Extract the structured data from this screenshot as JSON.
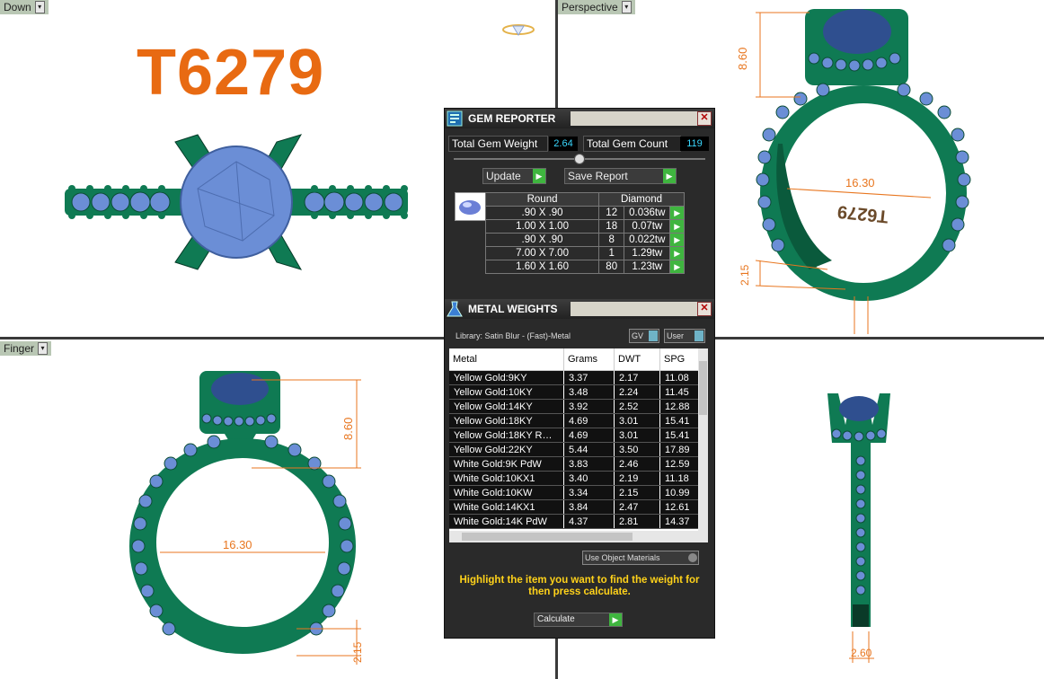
{
  "viewports": {
    "top_left_label": "Down",
    "top_right_label": "Perspective",
    "bottom_left_label": "Finger"
  },
  "logo_text": "T6279",
  "dimensions": {
    "front_height": "8.60",
    "front_inner": "16.30",
    "front_band": "2.15",
    "persp_height": "8.60",
    "persp_inner": "16.30",
    "persp_band": "2.15",
    "side_width": "2.60",
    "engraving": "T6279"
  },
  "gem_reporter": {
    "title": "GEM REPORTER",
    "total_weight_label": "Total Gem Weight",
    "total_weight_value": "2.64",
    "total_count_label": "Total Gem Count",
    "total_count_value": "119",
    "update_label": "Update",
    "save_report_label": "Save Report",
    "col_shape": "Round",
    "col_material": "Diamond",
    "rows": [
      {
        "size": ".90 X .90",
        "count": "12",
        "weight": "0.036tw"
      },
      {
        "size": "1.00 X 1.00",
        "count": "18",
        "weight": "0.07tw"
      },
      {
        "size": ".90 X .90",
        "count": "8",
        "weight": "0.022tw"
      },
      {
        "size": "7.00 X 7.00",
        "count": "1",
        "weight": "1.29tw"
      },
      {
        "size": "1.60 X 1.60",
        "count": "80",
        "weight": "1.23tw"
      }
    ]
  },
  "metal_weights": {
    "title": "METAL WEIGHTS",
    "library": "Library: Satin Blur - (Fast)-Metal",
    "gv_label": "GV",
    "user_label": "User",
    "headers": [
      "Metal",
      "Grams",
      "DWT",
      "SPG"
    ],
    "rows": [
      [
        "Yellow Gold:9KY",
        "3.37",
        "2.17",
        "11.08"
      ],
      [
        "Yellow Gold:10KY",
        "3.48",
        "2.24",
        "11.45"
      ],
      [
        "Yellow Gold:14KY",
        "3.92",
        "2.52",
        "12.88"
      ],
      [
        "Yellow Gold:18KY",
        "4.69",
        "3.01",
        "15.41"
      ],
      [
        "Yellow Gold:18KY R…",
        "4.69",
        "3.01",
        "15.41"
      ],
      [
        "Yellow Gold:22KY",
        "5.44",
        "3.50",
        "17.89"
      ],
      [
        "White Gold:9K PdW",
        "3.83",
        "2.46",
        "12.59"
      ],
      [
        "White Gold:10KX1",
        "3.40",
        "2.19",
        "11.18"
      ],
      [
        "White Gold:10KW",
        "3.34",
        "2.15",
        "10.99"
      ],
      [
        "White Gold:14KX1",
        "3.84",
        "2.47",
        "12.61"
      ],
      [
        "White Gold:14K PdW",
        "4.37",
        "2.81",
        "14.37"
      ]
    ],
    "use_object_materials": "Use Object Materials",
    "hint": "Highlight the item you want to find the weight for then press calculate.",
    "calculate_label": "Calculate"
  },
  "colors": {
    "metal": "#0f7a53",
    "gem": "#6b8ed6",
    "dimension": "#e8761f",
    "logo": "#e86a12"
  }
}
